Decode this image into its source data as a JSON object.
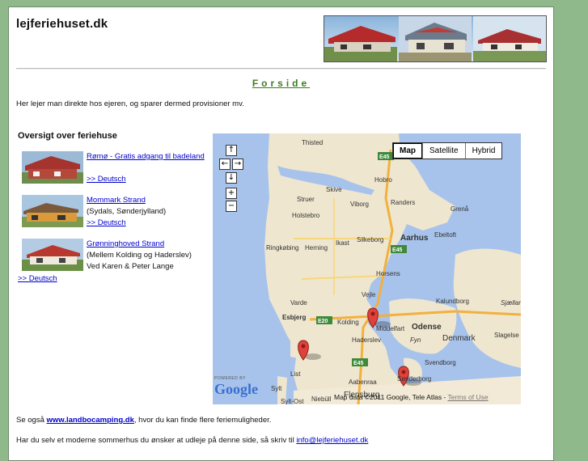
{
  "site": {
    "title": "lejferiehuset.dk"
  },
  "page": {
    "heading": "Forside",
    "intro": "Her lejer man direkte hos ejeren, og sparer dermed provisioner mv.",
    "overview_heading": "Oversigt over feriehuse"
  },
  "houses": [
    {
      "link": "Rømø - Gratis adgang til badeland",
      "lines": [],
      "deutsch": ">> Deutsch"
    },
    {
      "link": "Mommark Strand",
      "lines": [
        "(Sydals, Sønderjylland)"
      ],
      "deutsch": ">> Deutsch"
    },
    {
      "link": "Grønninghoved Strand",
      "lines": [
        "(Mellem Kolding og Haderslev)",
        "Ved Karen & Peter Lange"
      ],
      "deutsch": ">> Deutsch"
    }
  ],
  "map": {
    "types": [
      "Map",
      "Satellite",
      "Hybrid"
    ],
    "active_type": "Map",
    "controls": {
      "up": "↑",
      "left": "←",
      "right": "→",
      "down": "↓",
      "zoom_in": "+",
      "zoom_out": "−"
    },
    "cities": [
      "Thisted",
      "Hobro",
      "Skive",
      "Viborg",
      "Randers",
      "Struer",
      "Holstebro",
      "Grenå",
      "Aarhus",
      "Ebeltoft",
      "Ringkøbing",
      "Herning",
      "Ikast",
      "Silkeborg",
      "Horsens",
      "Varde",
      "Vejle",
      "Kalundborg",
      "Esbjerg",
      "Kolding",
      "Middelfart",
      "Odense",
      "Sjælland",
      "Slagelse",
      "Haderslev",
      "Fyn",
      "Denmark",
      "Svendborg",
      "Sønderborg",
      "Aabenraa",
      "Flensburg",
      "Sylt",
      "Sylt-Ost",
      "Niebüll",
      "List"
    ],
    "roads": [
      "E45",
      "E45",
      "E45",
      "E20",
      "E45"
    ],
    "markers": 3,
    "powered_by": "POWERED BY",
    "logo_text": "Google",
    "attribution": "Map data ©2011 Google, Tele Atlas -",
    "terms": "Terms of Use"
  },
  "footer": {
    "see_also_prefix": "Se også ",
    "see_also_link": "www.landbocamping.dk",
    "see_also_suffix": ", hvor du kan finde flere feriemuligheder.",
    "contact_prefix": "Har du selv et moderne sommerhus du ønsker at udleje på denne side, så skriv til ",
    "contact_link": "info@lejferiehuset.dk"
  },
  "colors": {
    "background": "#8fb98a",
    "heading_green": "#3c7d20",
    "link_blue": "#0000cc",
    "map_water": "#a7c3ec",
    "map_land": "#efe6cf",
    "marker_red": "#e0413a"
  }
}
